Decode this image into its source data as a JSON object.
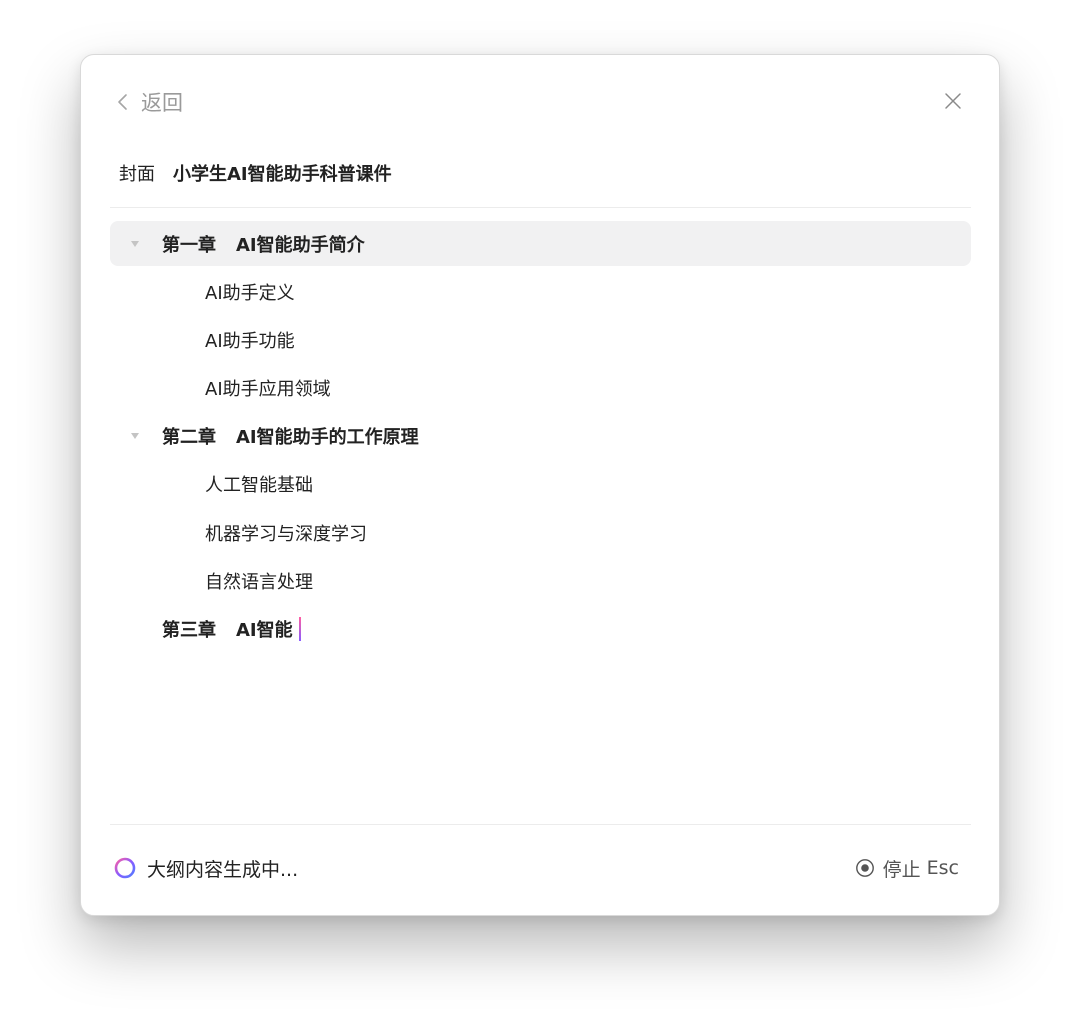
{
  "header": {
    "back_label": "返回",
    "back_icon": "chevron-left-icon",
    "close_icon": "close-icon"
  },
  "cover": {
    "label": "封面",
    "title": "小学生AI智能助手科普课件"
  },
  "outline": {
    "chapters": [
      {
        "number": "第一章",
        "title": "AI智能助手简介",
        "sections": [
          "AI助手定义",
          "AI助手功能",
          "AI助手应用领域"
        ]
      },
      {
        "number": "第二章",
        "title": "AI智能助手的工作原理",
        "sections": [
          "人工智能基础",
          "机器学习与深度学习",
          "自然语言处理"
        ]
      },
      {
        "number": "第三章",
        "title": "AI智能",
        "sections": []
      }
    ]
  },
  "footer": {
    "status": "大纲内容生成中...",
    "stop_label": "停止",
    "stop_shortcut": "Esc",
    "spinner_icon": "loading-ring-icon",
    "stop_icon": "stop-circle-icon"
  },
  "colors": {
    "text": "#222222",
    "muted": "#9a9a9a",
    "active_row": "#f1f1f2",
    "accent_pink": "#ff5fa2",
    "accent_purple": "#8a5cff",
    "accent_blue": "#4f7cff"
  }
}
